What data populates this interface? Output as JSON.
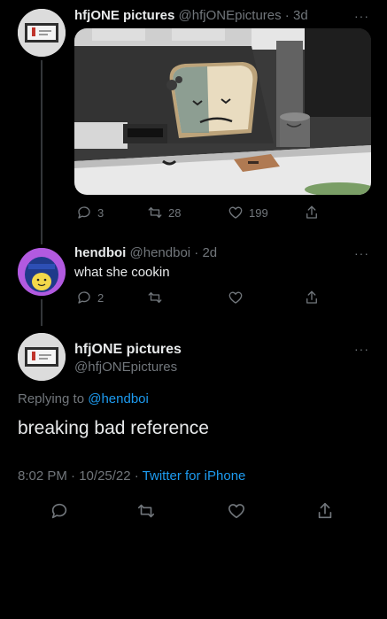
{
  "tweet1": {
    "name": "hfjONE pictures",
    "handle": "@hfjONEpictures",
    "time": "3d",
    "more": "···",
    "reply_count": "3",
    "retweet_count": "28",
    "like_count": "199"
  },
  "tweet2": {
    "name": "hendboi",
    "handle": "@hendboi",
    "time": "2d",
    "more": "···",
    "text": "what she cookin",
    "reply_count": "2"
  },
  "main": {
    "name": "hfjONE pictures",
    "handle": "@hfjONEpictures",
    "more": "···",
    "replying_prefix": "Replying to",
    "replying_handle": "@hendboi",
    "text": "breaking bad reference",
    "time": "8:02 PM",
    "date": "10/25/22",
    "source": "Twitter for iPhone"
  },
  "icons": {
    "reply": "reply-icon",
    "retweet": "retweet-icon",
    "like": "heart-icon",
    "share": "share-icon"
  },
  "colors": {
    "background": "#000000",
    "text": "#e7e9ea",
    "muted": "#71767b",
    "link": "#1d9bf0"
  }
}
